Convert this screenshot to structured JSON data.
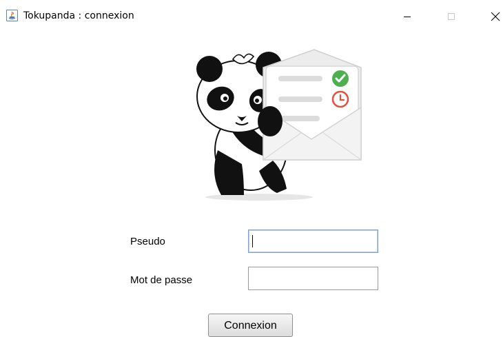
{
  "window": {
    "title": "Tokupanda : connexion",
    "app_icon": "java-icon",
    "controls": [
      "minimize-icon",
      "maximize-icon",
      "close-icon"
    ]
  },
  "illustration": {
    "icon": "panda-mail-illustration",
    "badges": [
      "check-icon",
      "clock-icon"
    ],
    "badge_colors": {
      "check": "#4caf50",
      "clock": "#e84c3d"
    }
  },
  "form": {
    "pseudo_label": "Pseudo",
    "pseudo_value": "",
    "password_label": "Mot de passe",
    "password_value": "",
    "submit_label": "Connexion"
  }
}
